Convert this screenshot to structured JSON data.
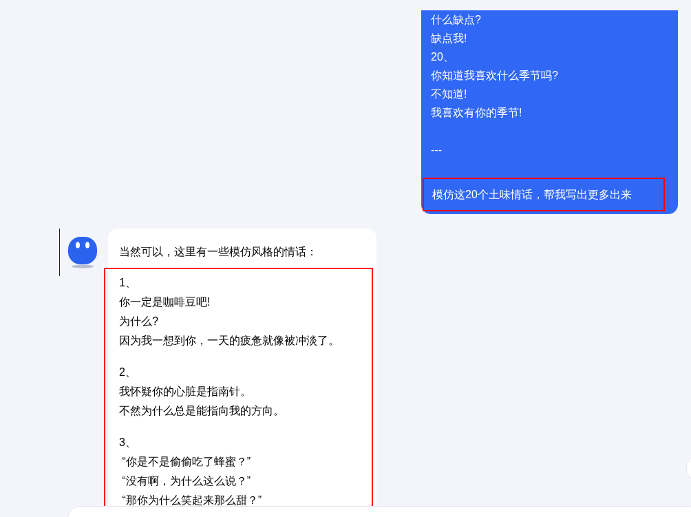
{
  "user_message": {
    "lines": [
      "什么缺点?",
      "缺点我!",
      "20、",
      "你知道我喜欢什么季节吗?",
      "不知道!",
      "我喜欢有你的季节!"
    ],
    "divider": "---",
    "request": {
      "text": "模仿这20个土味情话，帮我写出更多出来",
      "highlighted": true
    }
  },
  "assistant_message": {
    "intro": "当然可以，这里有一些模仿风格的情话：",
    "highlighted": true,
    "items": [
      {
        "number": "1、",
        "lines": [
          "你一定是咖啡豆吧!",
          "为什么?",
          "因为我一想到你，一天的疲惫就像被冲淡了。"
        ]
      },
      {
        "number": "2、",
        "lines": [
          "我怀疑你的心脏是指南针。",
          "不然为什么总是能指向我的方向。"
        ]
      },
      {
        "number": "3、",
        "lines": [
          " “你是不是偷偷吃了蜂蜜？”",
          " “没有啊，为什么这么说？”",
          " “那你为什么笑起来那么甜？”"
        ]
      }
    ]
  }
}
